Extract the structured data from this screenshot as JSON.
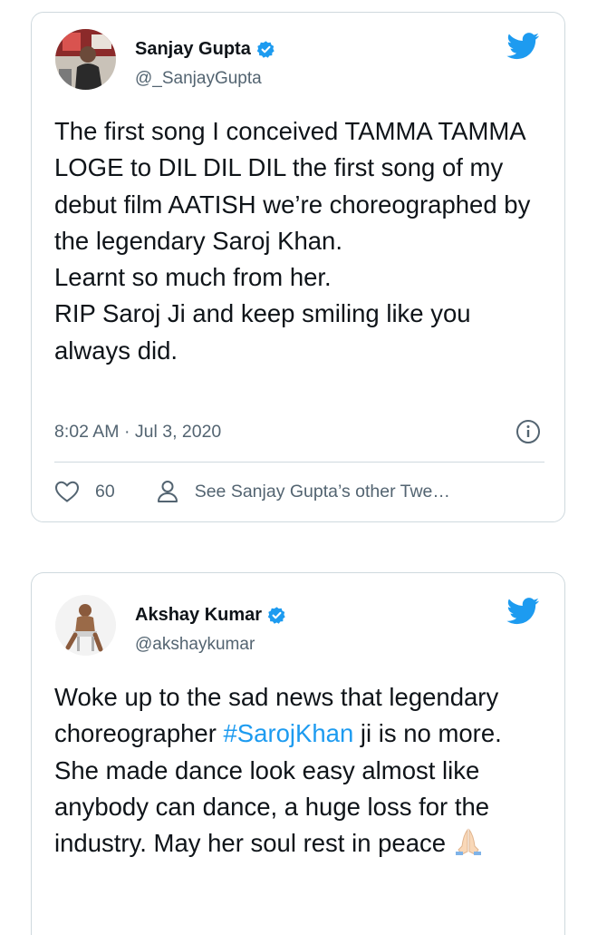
{
  "tweets": [
    {
      "name": "Sanjay Gupta",
      "handle": "@_SanjayGupta",
      "text": "The first song I conceived TAMMA TAMMA LOGE to DIL DIL DIL the first song of my debut film AATISH we’re choreographed by the legendary Saroj Khan.\nLearnt so much from her.\nRIP Saroj Ji and keep smiling like you always did.",
      "time": "8:02 AM · Jul 3, 2020",
      "likes": "60",
      "other_tweets_label": "See Sanjay Gupta’s other Twe…"
    },
    {
      "name": "Akshay Kumar",
      "handle": "@akshaykumar",
      "text_before": "Woke up to the sad news that legendary choreographer ",
      "hashtag": "#SarojKhan",
      "text_after": " ji is no more. She made dance look easy almost like anybody can dance, a huge loss for the industry. May her soul rest in peace "
    }
  ],
  "colors": {
    "twitter_blue": "#1d9bf0",
    "text": "#0f1419",
    "muted": "#536471",
    "border": "#cfd9de"
  },
  "icons": [
    "twitter-bird-icon",
    "verified-badge-icon",
    "info-icon",
    "heart-icon",
    "person-icon",
    "folded-hands-emoji"
  ]
}
